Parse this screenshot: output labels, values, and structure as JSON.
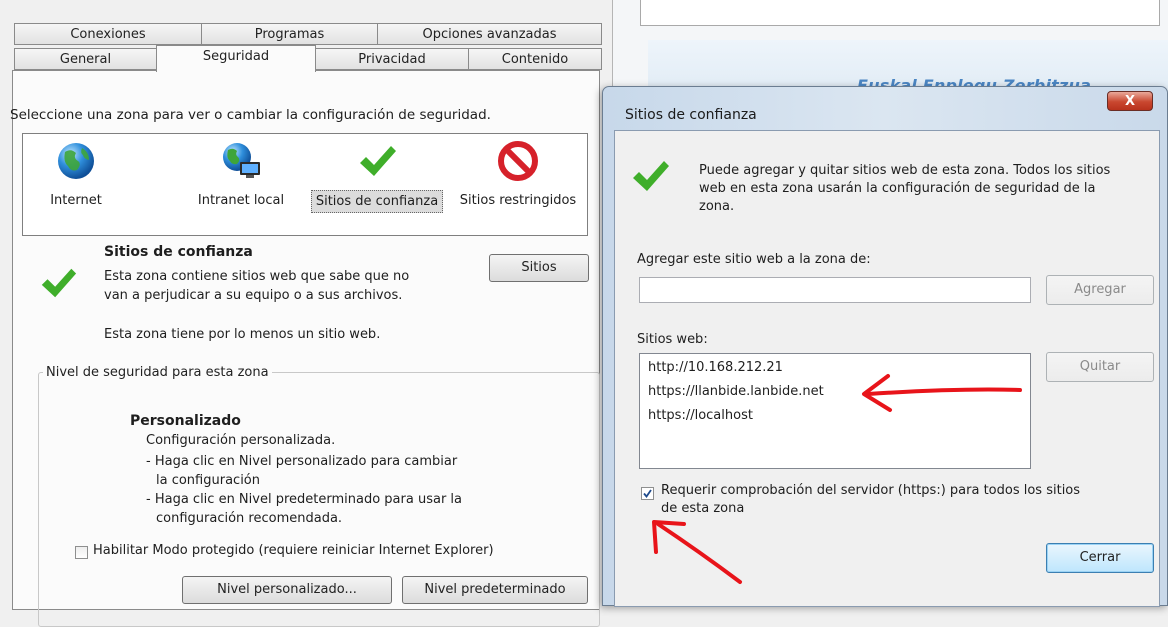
{
  "background_page": {
    "brand_text": "Euskal Enplegu Zerbitzua"
  },
  "internet_options": {
    "tabs_back": [
      "Conexiones",
      "Programas",
      "Opciones avanzadas"
    ],
    "tabs_front": [
      "General",
      "Seguridad",
      "Privacidad",
      "Contenido"
    ],
    "active_tab": "Seguridad",
    "zone_prompt": "Seleccione una zona para ver o cambiar la configuración de seguridad.",
    "zones": [
      {
        "label": "Internet",
        "icon": "globe-icon"
      },
      {
        "label": "Intranet local",
        "icon": "intranet-globe-icon"
      },
      {
        "label": "Sitios de confianza",
        "icon": "checkmark-icon",
        "selected": true
      },
      {
        "label": "Sitios restringidos",
        "icon": "prohibited-icon"
      }
    ],
    "zone_title": "Sitios de confianza",
    "zone_description_line1": "Esta zona contiene sitios web que sabe que no",
    "zone_description_line2": "van a perjudicar a su equipo o a sus archivos.",
    "zone_note": "Esta zona tiene por lo menos un sitio web.",
    "sites_button": "Sitios",
    "security_level_group": "Nivel de seguridad para esta zona",
    "level_title": "Personalizado",
    "level_lines": [
      "Configuración personalizada.",
      "- Haga clic en Nivel personalizado para cambiar",
      "la configuración",
      "- Haga clic en Nivel predeterminado para usar la",
      "configuración recomendada."
    ],
    "protected_mode_label": "Habilitar Modo protegido (requiere reiniciar Internet Explorer)",
    "protected_mode_checked": false,
    "custom_level_button": "Nivel personalizado...",
    "default_level_button": "Nivel predeterminado"
  },
  "trusted_sites_dialog": {
    "title": "Sitios de confianza",
    "close_label": "X",
    "info_line1": "Puede agregar y quitar sitios web de esta zona. Todos los sitios",
    "info_line2": "web en esta zona usarán la configuración de seguridad de la",
    "info_line3": "zona.",
    "add_label": "Agregar este sitio web a la zona de:",
    "add_input_value": "",
    "add_button": "Agregar",
    "sites_label": "Sitios web:",
    "sites": [
      "http://10.168.212.21",
      "https://llanbide.lanbide.net",
      "https://localhost"
    ],
    "remove_button": "Quitar",
    "require_https_line1": "Requerir comprobación del servidor (https:) para todos los sitios",
    "require_https_line2": "de esta zona",
    "require_https_checked": true,
    "close_button": "Cerrar"
  },
  "colors": {
    "annotation_arrow": "#e8141a",
    "check_green": "#3fae2a",
    "prohibited_red": "#d6212a"
  }
}
